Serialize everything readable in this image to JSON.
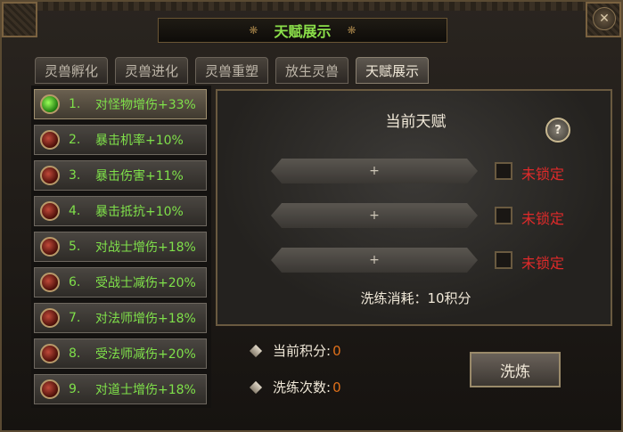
{
  "window": {
    "title": "天赋展示",
    "close_label": "✕"
  },
  "tabs": [
    {
      "label": "灵兽孵化",
      "active": false
    },
    {
      "label": "灵兽进化",
      "active": false
    },
    {
      "label": "灵兽重塑",
      "active": false
    },
    {
      "label": "放生灵兽",
      "active": false
    },
    {
      "label": "天赋展示",
      "active": true
    }
  ],
  "talent_list": [
    {
      "num": "1.",
      "text": "对怪物增伤+33%",
      "selected": true
    },
    {
      "num": "2.",
      "text": "暴击机率+10%",
      "selected": false
    },
    {
      "num": "3.",
      "text": "暴击伤害+11%",
      "selected": false
    },
    {
      "num": "4.",
      "text": "暴击抵抗+10%",
      "selected": false
    },
    {
      "num": "5.",
      "text": "对战士增伤+18%",
      "selected": false
    },
    {
      "num": "6.",
      "text": "受战士减伤+20%",
      "selected": false
    },
    {
      "num": "7.",
      "text": "对法师增伤+18%",
      "selected": false
    },
    {
      "num": "8.",
      "text": "受法师减伤+20%",
      "selected": false
    },
    {
      "num": "9.",
      "text": "对道士增伤+18%",
      "selected": false
    }
  ],
  "current_talent": {
    "title": "当前天赋",
    "help_label": "?",
    "slots": [
      {
        "symbol": "+",
        "lock_label": "未锁定"
      },
      {
        "symbol": "+",
        "lock_label": "未锁定"
      },
      {
        "symbol": "+",
        "lock_label": "未锁定"
      }
    ],
    "cost_text": "洗练消耗：10积分"
  },
  "stats": {
    "points_label": "当前积分:",
    "points_value": "0",
    "wash_count_label": "洗练次数:",
    "wash_count_value": "0"
  },
  "wash_button_label": "洗炼",
  "colors": {
    "green_text": "#7fe04a",
    "lock_red": "#e02a2a",
    "value_orange": "#e0701a"
  }
}
